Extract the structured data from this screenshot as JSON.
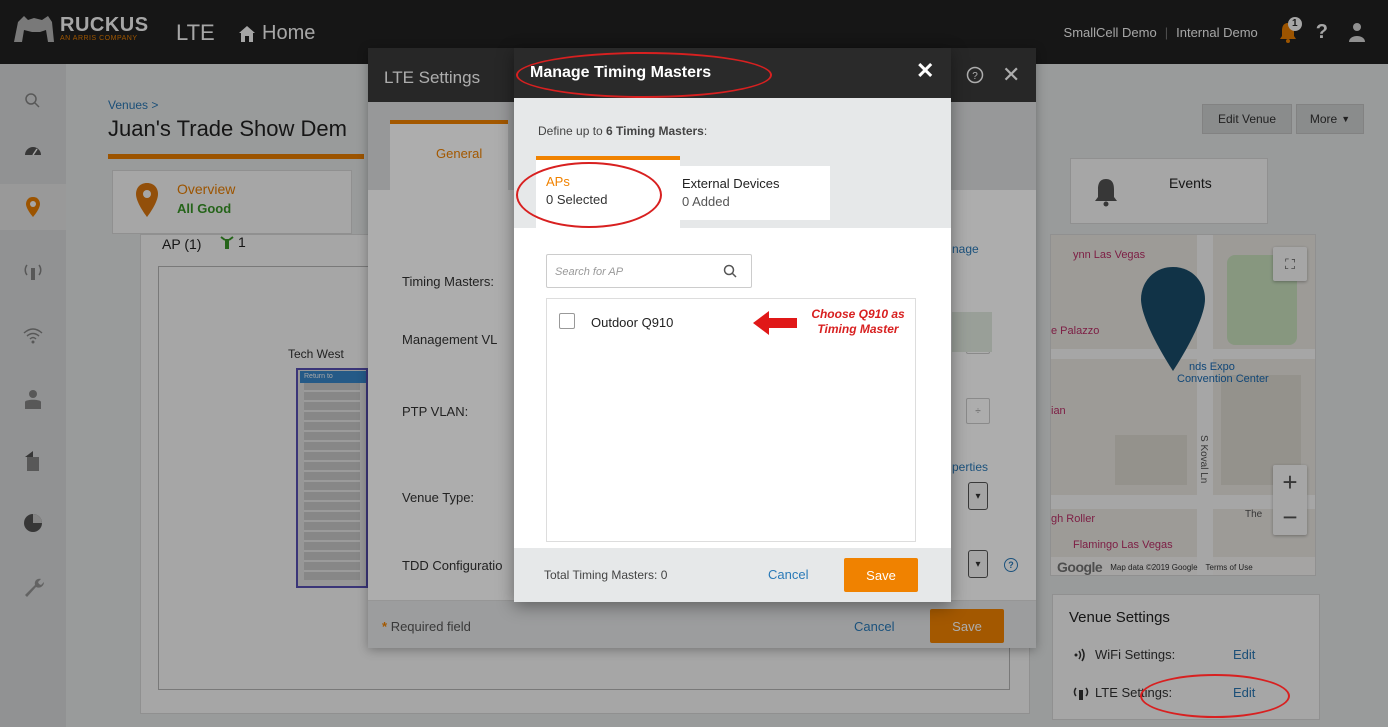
{
  "topbar": {
    "brand": "RUCKUS",
    "brand_sub": "AN ARRIS COMPANY",
    "product": "LTE",
    "home_label": "Home",
    "account_1": "SmallCell Demo",
    "account_2": "Internal Demo",
    "notifications_count": "1",
    "help_label": "?"
  },
  "venue": {
    "breadcrumb": "Venues >",
    "title": "Juan's Trade Show Dem",
    "edit_venue_label": "Edit Venue",
    "more_label": "More",
    "overview_label": "Overview",
    "overview_status": "All Good",
    "events_label": "Events",
    "ap_count_label": "AP (1)",
    "ap_online_count": "1",
    "floorplan_label": "Tech West",
    "floorplan_return": "Return to",
    "map": {
      "labels": [
        "ynn Las Vegas",
        "e Palazzo",
        "nds Expo",
        "Convention Center",
        "ian",
        "gh Roller",
        "Flamingo Las Vegas",
        "S Koval Ln",
        "The"
      ],
      "footer_data": "Map data ©2019 Google",
      "footer_terms": "Terms of Use",
      "google_label": "Google",
      "fullscreen_glyph": "⛶",
      "zoom_in": "+",
      "zoom_out": "−"
    },
    "venue_settings": {
      "title": "Venue Settings",
      "wifi_label": "WiFi Settings:",
      "wifi_edit": "Edit",
      "lte_label": "LTE Settings:",
      "lte_edit": "Edit"
    }
  },
  "lte_dialog": {
    "title": "LTE Settings",
    "tab_general": "General",
    "fields": {
      "timing_masters": "Timing Masters:",
      "management_vlan": "Management VL",
      "ptp_vlan": "PTP VLAN:",
      "venue_type": "Venue Type:",
      "tdd_config": "TDD Configuratio"
    },
    "manage_link": "nage",
    "properties_link": "perties",
    "required_field": "Required field",
    "required_star": "*",
    "cancel_label": "Cancel",
    "save_label": "Save"
  },
  "timing_dialog": {
    "title": "Manage Timing Masters",
    "define_prefix": "Define up to ",
    "define_bold": "6 Timing Masters",
    "define_suffix": ":",
    "tab_aps_title": "APs",
    "tab_aps_sub": "0 Selected",
    "tab_ext_title": "External Devices",
    "tab_ext_sub": "0 Added",
    "search_placeholder": "Search for AP",
    "items": [
      {
        "label": "Outdoor Q910",
        "checked": false
      }
    ],
    "annotation_line1": "Choose Q910 as",
    "annotation_line2": "Timing Master",
    "total_label": "Total Timing Masters: 0",
    "cancel_label": "Cancel",
    "save_label": "Save"
  },
  "colors": {
    "accent": "#f08200",
    "link": "#2a7ab8",
    "annotation": "#d82020",
    "header_dark": "#2a2a2a"
  }
}
